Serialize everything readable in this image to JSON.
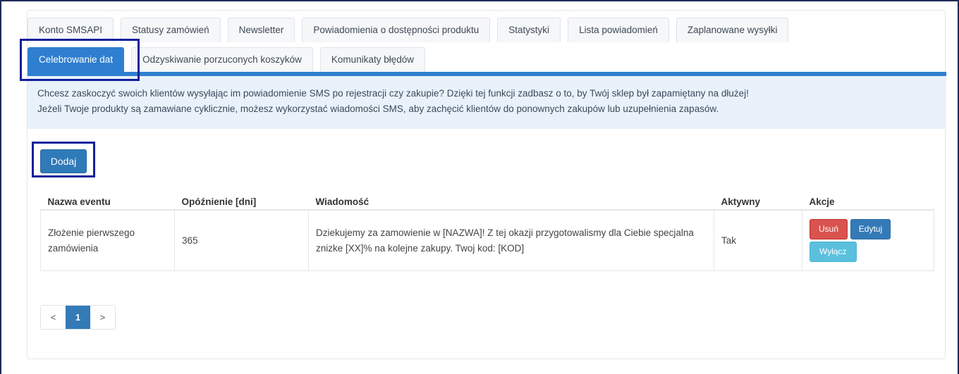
{
  "tabs_row1": [
    "Konto SMSAPI",
    "Statusy zamówień",
    "Newsletter",
    "Powiadomienia o dostępności produktu",
    "Statystyki",
    "Lista powiadomień",
    "Zaplanowane wysyłki"
  ],
  "tabs_row2": [
    "Celebrowanie dat",
    "Odzyskiwanie porzuconych koszyków",
    "Komunikaty błędów"
  ],
  "active_tab": "Celebrowanie dat",
  "info": {
    "line1": "Chcesz zaskoczyć swoich klientów wysyłając im powiadomienie SMS po rejestracji czy zakupie? Dzięki tej funkcji zadbasz o to, by Twój sklep był zapamiętany na dłużej!",
    "line2": "Jeżeli Twoje produkty są zamawiane cyklicznie, możesz wykorzystać wiadomości SMS, aby zachęcić klientów do ponownych zakupów lub uzupełnienia zapasów."
  },
  "add_button": "Dodaj",
  "table": {
    "headers": [
      "Nazwa eventu",
      "Opóźnienie [dni]",
      "Wiadomość",
      "Aktywny",
      "Akcje"
    ],
    "rows": [
      {
        "name": "Złożenie pierwszego zamówienia",
        "delay": "365",
        "message": "Dziekujemy za zamowienie w [NAZWA]! Z tej okazji przygotowalismy dla Ciebie specjalna znizke [XX]% na kolejne zakupy. Twoj kod: [KOD]",
        "active": "Tak",
        "actions": {
          "delete": "Usuń",
          "edit": "Edytuj",
          "disable": "Wyłącz"
        }
      }
    ]
  },
  "pagination": {
    "prev": "<",
    "current": "1",
    "next": ">"
  },
  "colors": {
    "accent": "#2f7fd0",
    "highlight": "#10209a",
    "danger": "#d9534f",
    "info": "#5bc0de"
  }
}
